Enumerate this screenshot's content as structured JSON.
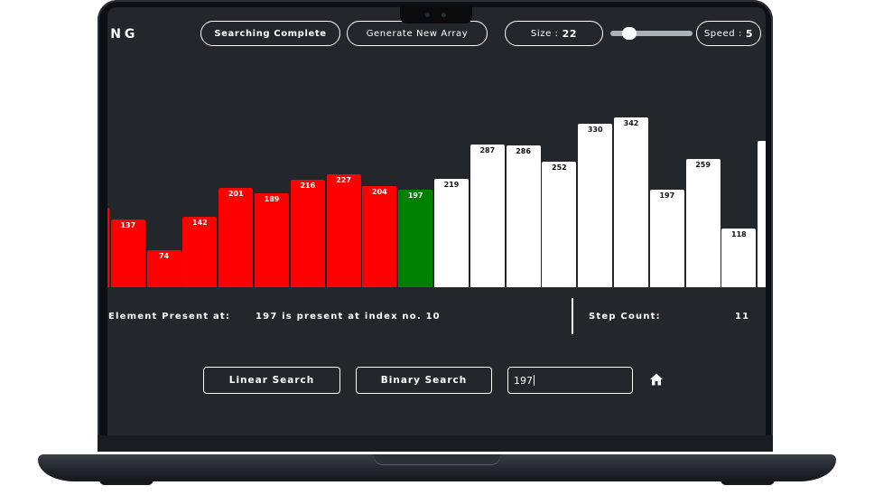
{
  "header": {
    "logo_text": "ING",
    "status_label": "Searching Complete",
    "generate_label": "Generate New Array",
    "size_label": "Size :",
    "size_value": "22",
    "speed_label": "Speed :",
    "speed_value": "5"
  },
  "bars": [
    {
      "value": "",
      "state": "red"
    },
    {
      "value": "137",
      "state": "red"
    },
    {
      "value": "74",
      "state": "red"
    },
    {
      "value": "142",
      "state": "red"
    },
    {
      "value": "201",
      "state": "red"
    },
    {
      "value": "189",
      "state": "red"
    },
    {
      "value": "216",
      "state": "red"
    },
    {
      "value": "227",
      "state": "red"
    },
    {
      "value": "204",
      "state": "red"
    },
    {
      "value": "197",
      "state": "green"
    },
    {
      "value": "219",
      "state": "white"
    },
    {
      "value": "287",
      "state": "white"
    },
    {
      "value": "286",
      "state": "white"
    },
    {
      "value": "252",
      "state": "white"
    },
    {
      "value": "330",
      "state": "white"
    },
    {
      "value": "342",
      "state": "white"
    },
    {
      "value": "197",
      "state": "white"
    },
    {
      "value": "259",
      "state": "white"
    },
    {
      "value": "118",
      "state": "white"
    },
    {
      "value": "",
      "state": "white"
    }
  ],
  "result": {
    "label": "Element Present at:",
    "value": "197 is present at index no. 10",
    "step_label": "Step Count:",
    "step_value": "11"
  },
  "controls": {
    "linear_label": "Linear Search",
    "binary_label": "Binary Search",
    "search_value": "197"
  },
  "colors": {
    "background": "#23262b",
    "visited": "#ff0000",
    "found": "#008000",
    "unvisited": "#ffffff"
  }
}
